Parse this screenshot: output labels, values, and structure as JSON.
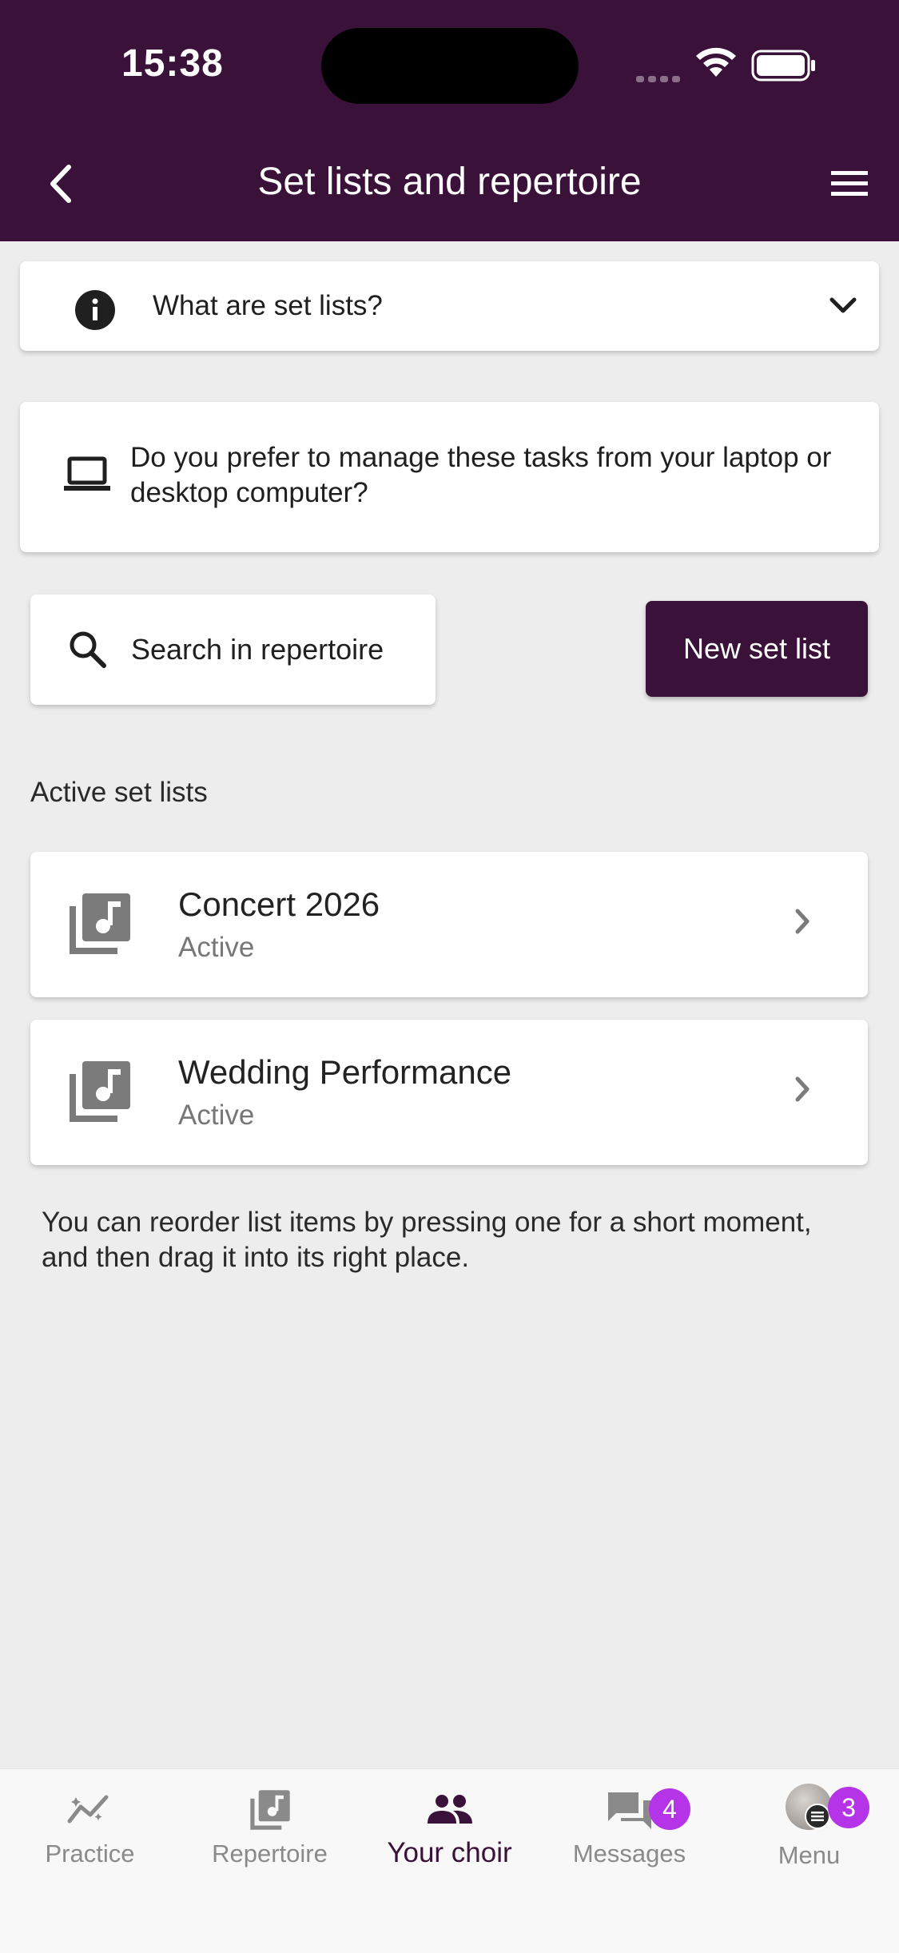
{
  "status_bar": {
    "time": "15:38"
  },
  "header": {
    "title": "Set lists and repertoire"
  },
  "info_panel": {
    "label": "What are set lists?"
  },
  "desktop_card": {
    "text": "Do you prefer to manage these tasks from your laptop or desktop computer?"
  },
  "actions": {
    "search_label": "Search in repertoire",
    "new_setlist_label": "New set list"
  },
  "section": {
    "title": "Active set lists"
  },
  "setlists": [
    {
      "name": "Concert 2026",
      "status": "Active"
    },
    {
      "name": "Wedding Performance",
      "status": "Active"
    }
  ],
  "hint": "You can reorder list items by pressing one for a short moment, and then drag it into its right place.",
  "bottom_nav": {
    "items": [
      {
        "label": "Practice",
        "icon": "trend-icon"
      },
      {
        "label": "Repertoire",
        "icon": "music-library-icon"
      },
      {
        "label": "Your choir",
        "icon": "people-icon"
      },
      {
        "label": "Messages",
        "icon": "chat-icon"
      },
      {
        "label": "Menu",
        "icon": "avatar"
      }
    ],
    "messages_badge": "4",
    "menu_badge": "3"
  },
  "colors": {
    "brand": "#3a1139",
    "badge": "#b534e8",
    "background": "#ededed"
  }
}
